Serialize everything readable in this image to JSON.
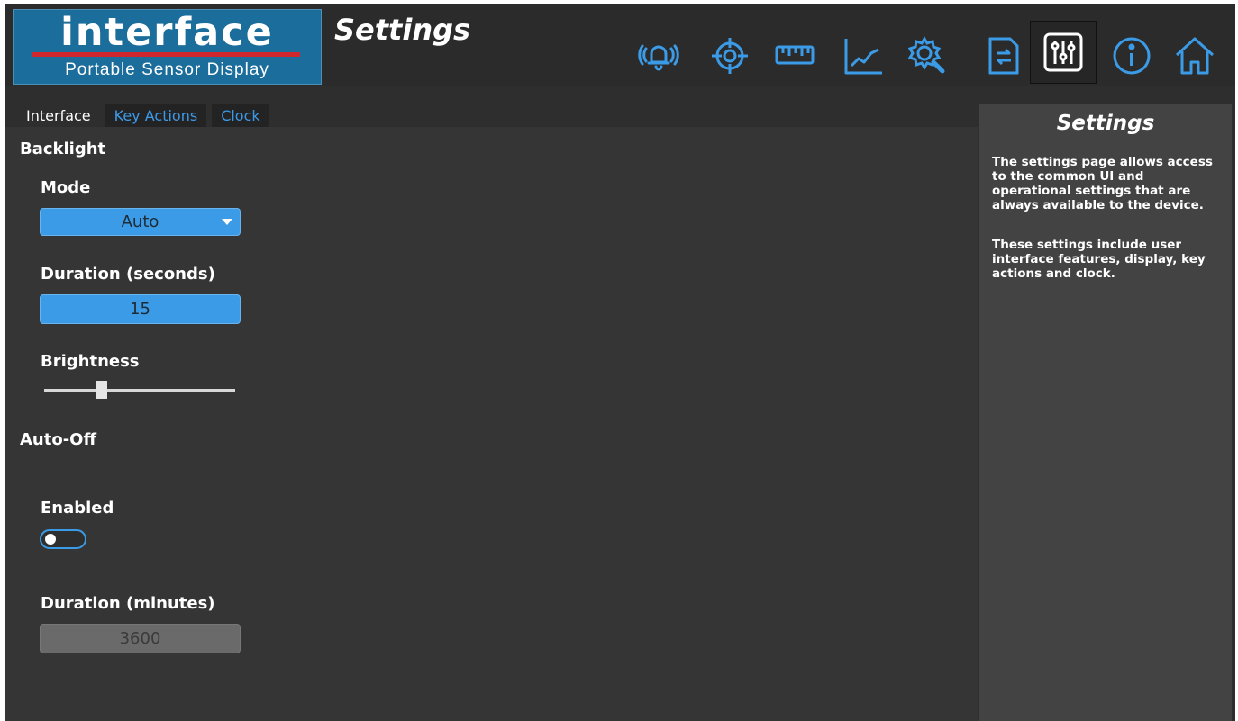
{
  "header": {
    "logo_word": "interface",
    "logo_subtitle": "Portable Sensor Display",
    "page_title": "Settings",
    "accent_color": "#3b9be6",
    "icons": [
      {
        "name": "alarm-icon",
        "active": false
      },
      {
        "name": "target-icon",
        "active": false
      },
      {
        "name": "ruler-icon",
        "active": false
      },
      {
        "name": "chart-icon",
        "active": false
      },
      {
        "name": "gear-wrench-icon",
        "active": false
      },
      {
        "name": "file-transfer-icon",
        "active": false
      },
      {
        "name": "sliders-icon",
        "active": true
      },
      {
        "name": "info-icon",
        "active": false
      },
      {
        "name": "home-icon",
        "active": false
      }
    ]
  },
  "tabs": [
    {
      "label": "Interface",
      "active": true
    },
    {
      "label": "Key Actions",
      "active": false
    },
    {
      "label": "Clock",
      "active": false
    }
  ],
  "backlight": {
    "section_label": "Backlight",
    "mode_label": "Mode",
    "mode_value": "Auto",
    "duration_label": "Duration (seconds)",
    "duration_value": "15",
    "brightness_label": "Brightness",
    "brightness_fraction": 0.3
  },
  "auto_off": {
    "section_label": "Auto-Off",
    "enabled_label": "Enabled",
    "enabled": false,
    "duration_label": "Duration (minutes)",
    "duration_value": "3600"
  },
  "help": {
    "title": "Settings",
    "paragraph1": "The settings page allows access to the common UI and operational settings that are always available to the device.",
    "paragraph2": "These settings include user interface features, display, key actions and clock."
  }
}
